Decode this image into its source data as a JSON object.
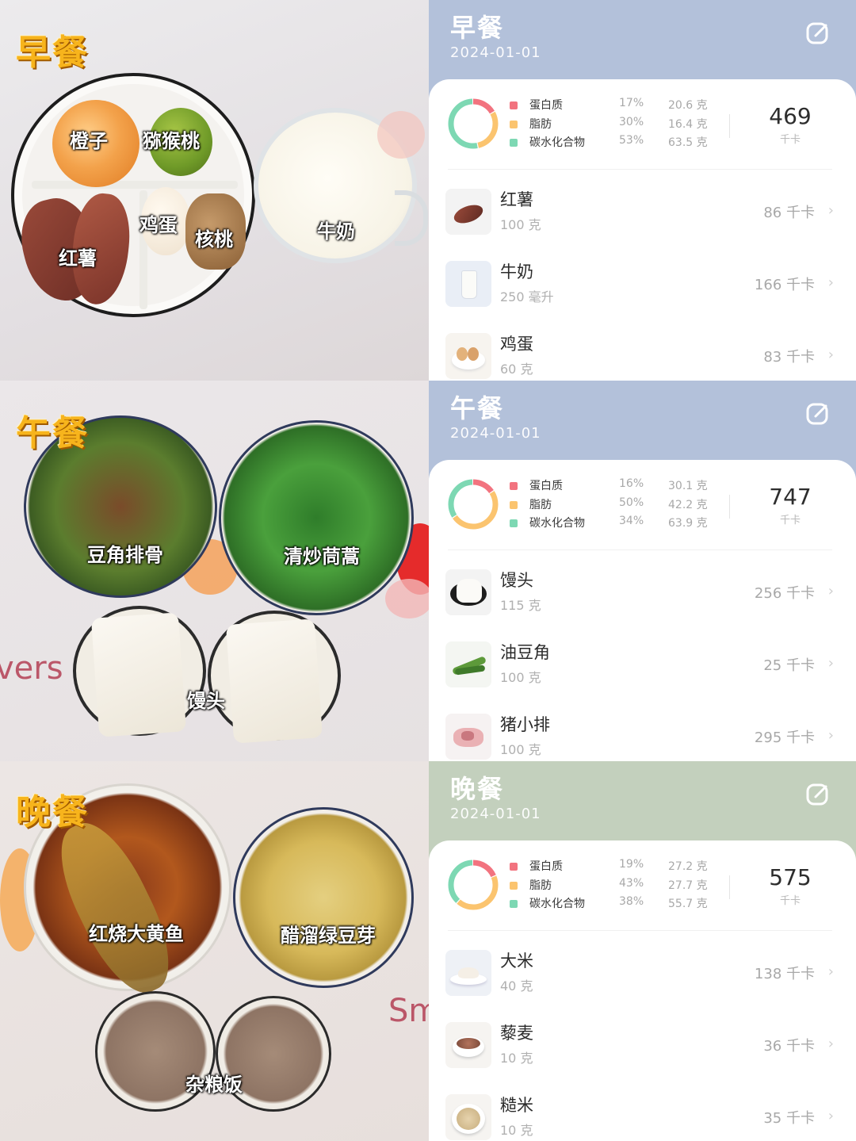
{
  "colors": {
    "protein": "#f2737f",
    "fat": "#fbc46f",
    "carbs": "#7dd8b3",
    "head_blue": "#b3c1da",
    "head_green": "#c3d0bd",
    "label_gold": "#f7b41c"
  },
  "meals": [
    {
      "photo": {
        "title": "早餐",
        "labels": [
          "橙子",
          "猕猴桃",
          "鸡蛋",
          "核桃",
          "红薯",
          "牛奶"
        ]
      },
      "title": "早餐",
      "date": "2024-01-01",
      "edit_icon": "edit-icon",
      "macros": [
        {
          "name": "蛋白质",
          "pct": "17%",
          "gram": "20.6 克",
          "fraction": 0.17
        },
        {
          "name": "脂肪",
          "pct": "30%",
          "gram": "16.4 克",
          "fraction": 0.3
        },
        {
          "name": "碳水化合物",
          "pct": "53%",
          "gram": "63.5 克",
          "fraction": 0.53
        }
      ],
      "kcal": "469",
      "kcal_unit": "千卡",
      "items": [
        {
          "name": "红薯",
          "amount": "100 克",
          "kcal": "86 千卡",
          "icon": "sweet-potato-icon"
        },
        {
          "name": "牛奶",
          "amount": "250 毫升",
          "kcal": "166 千卡",
          "icon": "milk-icon"
        },
        {
          "name": "鸡蛋",
          "amount": "60 克",
          "kcal": "83 千卡",
          "icon": "egg-icon"
        }
      ]
    },
    {
      "photo": {
        "title": "午餐",
        "labels": [
          "豆角排骨",
          "清炒茼蒿",
          "馒头"
        ]
      },
      "title": "午餐",
      "date": "2024-01-01",
      "edit_icon": "edit-icon",
      "macros": [
        {
          "name": "蛋白质",
          "pct": "16%",
          "gram": "30.1 克",
          "fraction": 0.16
        },
        {
          "name": "脂肪",
          "pct": "50%",
          "gram": "42.2 克",
          "fraction": 0.5
        },
        {
          "name": "碳水化合物",
          "pct": "34%",
          "gram": "63.9 克",
          "fraction": 0.34
        }
      ],
      "kcal": "747",
      "kcal_unit": "千卡",
      "items": [
        {
          "name": "馒头",
          "amount": "115 克",
          "kcal": "256 千卡",
          "icon": "steamed-bun-icon"
        },
        {
          "name": "油豆角",
          "amount": "100 克",
          "kcal": "25 千卡",
          "icon": "green-bean-icon"
        },
        {
          "name": "猪小排",
          "amount": "100 克",
          "kcal": "295 千卡",
          "icon": "pork-ribs-icon"
        }
      ]
    },
    {
      "photo": {
        "title": "晚餐",
        "labels": [
          "红烧大黄鱼",
          "醋溜绿豆芽",
          "杂粮饭"
        ],
        "deco": "Sm"
      },
      "title": "晚餐",
      "date": "2024-01-01",
      "edit_icon": "edit-icon",
      "macros": [
        {
          "name": "蛋白质",
          "pct": "19%",
          "gram": "27.2 克",
          "fraction": 0.19
        },
        {
          "name": "脂肪",
          "pct": "43%",
          "gram": "27.7 克",
          "fraction": 0.43
        },
        {
          "name": "碳水化合物",
          "pct": "38%",
          "gram": "55.7 克",
          "fraction": 0.38
        }
      ],
      "kcal": "575",
      "kcal_unit": "千卡",
      "items": [
        {
          "name": "大米",
          "amount": "40 克",
          "kcal": "138 千卡",
          "icon": "rice-icon"
        },
        {
          "name": "藜麦",
          "amount": "10 克",
          "kcal": "36 千卡",
          "icon": "quinoa-icon"
        },
        {
          "name": "糙米",
          "amount": "10 克",
          "kcal": "35 千卡",
          "icon": "brown-rice-icon"
        }
      ]
    }
  ],
  "photo2_deco": "vers"
}
